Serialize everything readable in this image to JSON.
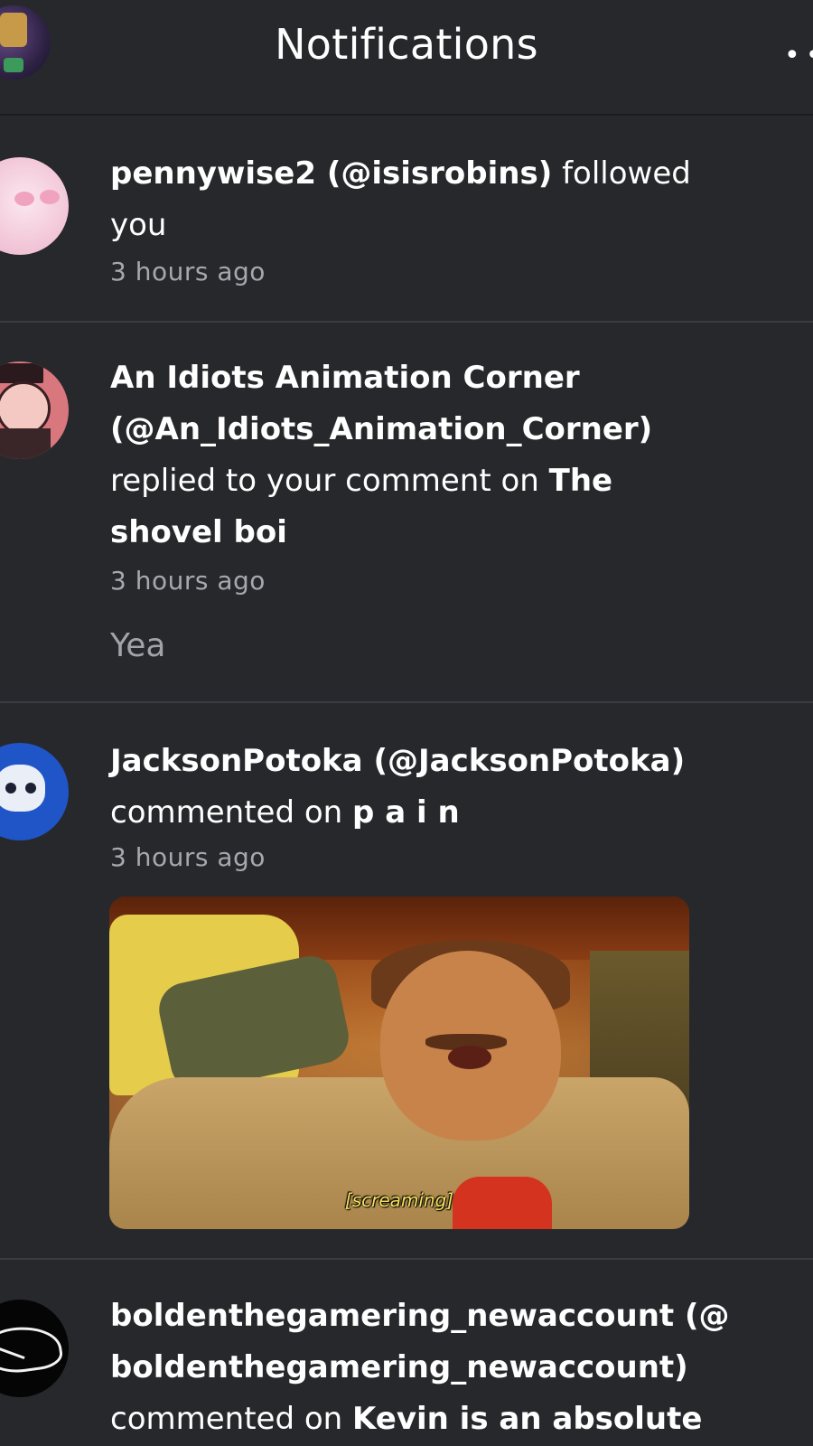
{
  "header": {
    "title": "Notifications",
    "more_glyph": "••"
  },
  "notifications": [
    {
      "user_display": "pennywise2 (@isisrobins)",
      "action": "followed you",
      "time": "3 hours ago"
    },
    {
      "user_display": "An Idiots Animation Corner (@An_Idiots_Animation_Corner)",
      "action": "replied to your comment on",
      "post_title": "The shovel boi",
      "time": "3 hours ago",
      "reply_text": "Yea"
    },
    {
      "user_display": "JacksonPotoka (@JacksonPotoka)",
      "action": "commented on",
      "post_title": "p a i n",
      "time": "3 hours ago",
      "gif_caption": "[screaming]"
    },
    {
      "user_display": "boldenthegamering_newaccount (@ boldenthegamering_newaccount)",
      "action": "commented on",
      "post_title": "Kevin is an absolute"
    }
  ],
  "colors": {
    "background": "#27282c",
    "divider": "#3a3b40",
    "muted_text": "#a7a8ad"
  }
}
